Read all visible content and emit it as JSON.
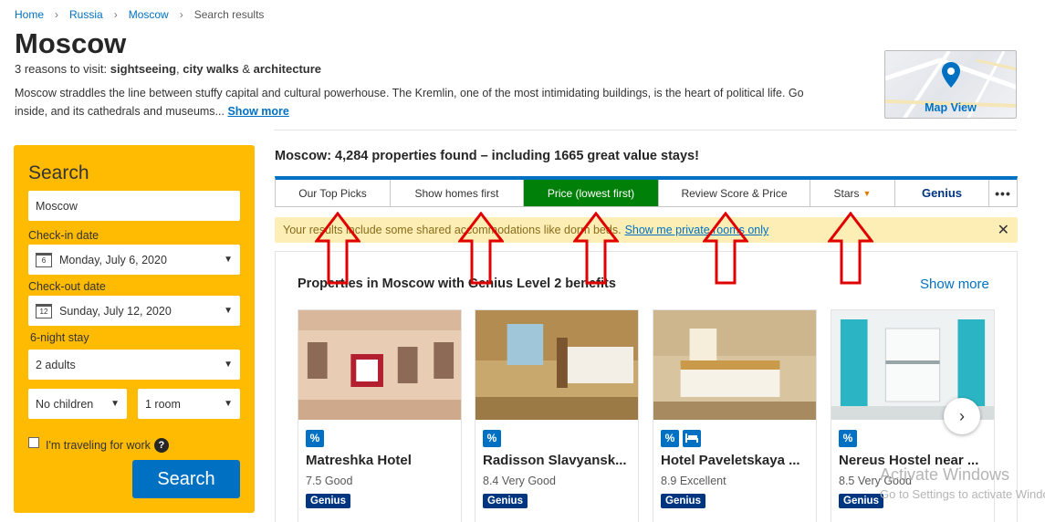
{
  "breadcrumb": {
    "home": "Home",
    "country": "Russia",
    "city": "Moscow",
    "current": "Search results"
  },
  "page": {
    "title": "Moscow",
    "reasons_prefix": "3 reasons to visit: ",
    "reason1": "sightseeing",
    "reason_sep1": ", ",
    "reason2": "city walks",
    "reason_sep2": " & ",
    "reason3": "architecture",
    "description": "Moscow straddles the line between stuffy capital and cultural powerhouse. The Kremlin, one of the most intimidating buildings, is the heart of political life. Go inside, and its cathedrals and museums...",
    "show_more": "Show more",
    "map_view": "Map View"
  },
  "search": {
    "title": "Search",
    "destination": "Moscow",
    "checkin_label": "Check-in date",
    "checkin_value": "Monday, July 6, 2020",
    "checkin_day": "6",
    "checkout_label": "Check-out date",
    "checkout_value": "Sunday, July 12, 2020",
    "checkout_day": "12",
    "stay_length": "6-night stay",
    "adults": "2 adults",
    "children": "No children",
    "rooms": "1 room",
    "work_travel": "I'm traveling for work",
    "help": "?",
    "button": "Search"
  },
  "results": {
    "heading": "Moscow: 4,284 properties found – including 1665 great value stays!",
    "sort_tabs": [
      "Our Top Picks",
      "Show homes first",
      "Price (lowest first)",
      "Review Score & Price",
      "Stars",
      "Genius",
      "•••"
    ],
    "notice_text": "Your results include some shared accommodations like dorm beds.",
    "notice_link": "Show me private rooms only",
    "notice_close": "✕"
  },
  "genius_section": {
    "title": "Properties in Moscow with Genius Level 2 benefits",
    "show_more": "Show more",
    "next": "›",
    "cards": [
      {
        "name": "Matreshka Hotel",
        "score": "7.5 Good",
        "badge": "Genius"
      },
      {
        "name": "Radisson Slavyansk...",
        "score": "8.4 Very Good",
        "badge": "Genius"
      },
      {
        "name": "Hotel Paveletskaya ...",
        "score": "8.9 Excellent",
        "badge": "Genius"
      },
      {
        "name": "Nereus Hostel near ...",
        "score": "8.5 Very Good",
        "badge": "Genius"
      }
    ]
  },
  "watermark": {
    "line1": "Activate Windows",
    "line2": "Go to Settings to activate Windows."
  },
  "colors": {
    "brand_blue": "#0071c2",
    "search_yellow": "#febb02",
    "active_green": "#008009",
    "genius_navy": "#003580",
    "annotation_red": "#e00000"
  }
}
